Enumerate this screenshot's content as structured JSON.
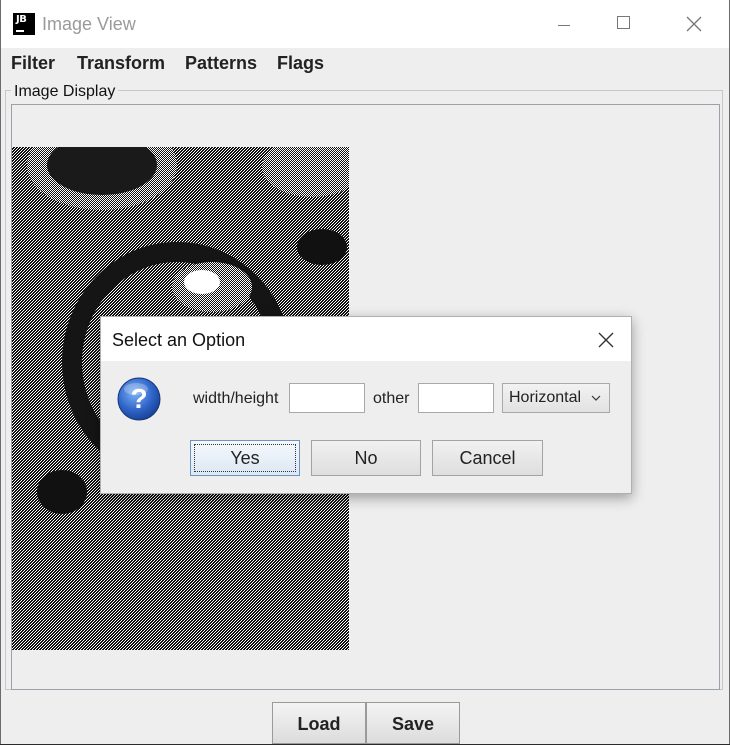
{
  "window": {
    "title": "Image View"
  },
  "menu": [
    "Filter",
    "Transform",
    "Patterns",
    "Flags"
  ],
  "panel": {
    "title": "Image Display"
  },
  "buttons": {
    "load": "Load",
    "save": "Save"
  },
  "dialog": {
    "title": "Select an Option",
    "labels": {
      "width_height": "width/height",
      "other": "other"
    },
    "fields": {
      "width_height": "",
      "other": ""
    },
    "orientation": "Horizontal",
    "buttons": {
      "yes": "Yes",
      "no": "No",
      "cancel": "Cancel"
    }
  }
}
